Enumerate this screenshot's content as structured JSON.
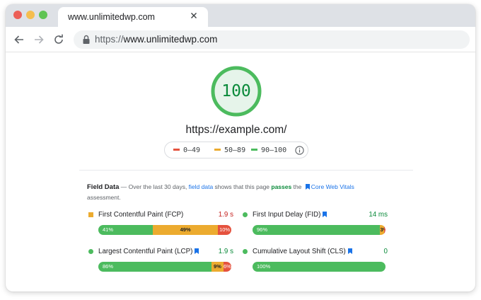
{
  "browser": {
    "tab_title": "www.unlimitedwp.com",
    "url_protocol": "https://",
    "url_host": "www.unlimitedwp.com"
  },
  "report": {
    "score": "100",
    "score_color": "#0a8a3a",
    "site_url": "https://example.com/",
    "legend": [
      {
        "label": "0–49",
        "color": "#e5523e"
      },
      {
        "label": "50–89",
        "color": "#ecab2f"
      },
      {
        "label": "90–100",
        "color": "#4cbb5e"
      }
    ],
    "field_data": {
      "title": "Field Data",
      "dash": " — Over the last 30 days, ",
      "link1": "field data",
      "mid1": " shows that this page ",
      "pass": "passes",
      "mid2": " the ",
      "link2": "Core Web Vitals",
      "end": "assessment."
    },
    "metrics": [
      {
        "label": "First Contentful Paint (FCP)",
        "value": "1.9 s",
        "value_color": "#c5221f",
        "status_color": "#ecab2f",
        "segments": [
          {
            "pct": 41,
            "label": "41%"
          },
          {
            "pct": 49,
            "label": "49%"
          },
          {
            "pct": 10,
            "label": "10%"
          }
        ]
      },
      {
        "label": "First Input Delay (FID)",
        "value": "14 ms",
        "value_color": "#0a8a3a",
        "status_color": "#4cbb5e",
        "segments": [
          {
            "pct": 96,
            "label": "96%"
          },
          {
            "pct": 3,
            "label": "3%"
          },
          {
            "pct": 1,
            "label": "1%"
          }
        ]
      },
      {
        "label": "Largest Contentful Paint (LCP)",
        "value": "1.9 s",
        "value_color": "#0a8a3a",
        "status_color": "#4cbb5e",
        "segments": [
          {
            "pct": 86,
            "label": "86%"
          },
          {
            "pct": 9,
            "label": "9%"
          },
          {
            "pct": 6,
            "label": "6%"
          }
        ]
      },
      {
        "label": "Cumulative Layout Shift (CLS)",
        "value": "0",
        "value_color": "#0a8a3a",
        "status_color": "#4cbb5e",
        "segments": [
          {
            "pct": 100,
            "label": "100%"
          },
          {
            "pct": 0,
            "label": ""
          },
          {
            "pct": 0,
            "label": ""
          }
        ]
      }
    ]
  }
}
